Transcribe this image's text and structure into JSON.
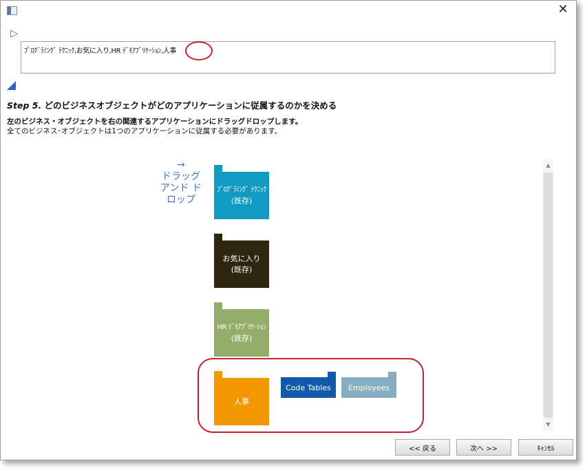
{
  "window": {
    "close_glyph": "✕"
  },
  "toolbar": {
    "play_glyph": "▷"
  },
  "path": {
    "value": "ﾌﾟﾛｸﾞﾗﾐﾝｸﾞ ﾃｸﾆｯｸ,お気に入り,HR ﾃﾞﾓｱﾌﾟﾘｹｰｼｮﾝ,人事"
  },
  "step": {
    "number": "Step 5.",
    "title": " どのビジネスオブジェクトがどのアプリケーションに従属するのかを決める"
  },
  "instructions": {
    "line1": "左のビジネス・オブジェクトを右の関連するアプリケーションにドラッグドロップします。",
    "line2": "全てのビジネス･オブジェクトは1つのアプリケーションに従属する必要があります。"
  },
  "drag_hint": {
    "arrow": "→",
    "text": "ドラッグ アンド ドロップ"
  },
  "applications": [
    {
      "name": "ﾌﾟﾛｸﾞﾗﾐﾝｸﾞ ﾃｸﾆｯｸ",
      "status": "(既存)",
      "color": "#119bc2"
    },
    {
      "name": "お気に入り",
      "status": "(既存)",
      "color": "#2e2610"
    },
    {
      "name": "HR ﾃﾞﾓｱﾌﾟﾘｹｰｼｮﾝ",
      "status": "(既存)",
      "color": "#95ad6b"
    },
    {
      "name": "人事",
      "status": "",
      "color": "#f49800"
    }
  ],
  "business_objects": [
    {
      "label": "Code Tables",
      "color": "#0f5ba8"
    },
    {
      "label": "Employees",
      "color": "#86adbd"
    }
  ],
  "scrollbar": {
    "up": "▲",
    "down": "▼"
  },
  "buttons": {
    "back": "<< 戻る",
    "next": "次へ >>",
    "cancel": "ｷｬﾝｾﾙ"
  },
  "colors": {
    "accent": "#3a76c5",
    "highlight": "#c0202a"
  }
}
